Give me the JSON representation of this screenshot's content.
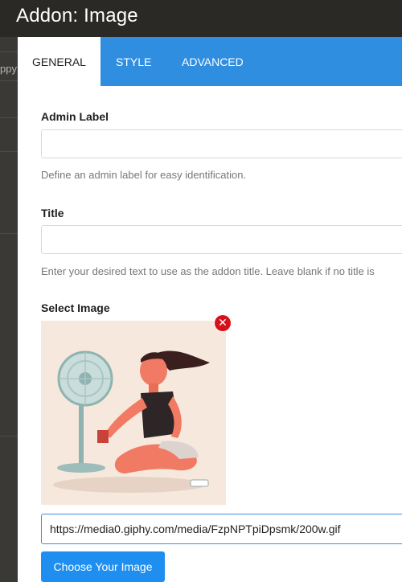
{
  "app": {
    "title": "Addon: Image"
  },
  "backdrop": {
    "fragment": "ppy"
  },
  "tabs": [
    {
      "label": "GENERAL",
      "active": true
    },
    {
      "label": "STYLE",
      "active": false
    },
    {
      "label": "ADVANCED",
      "active": false
    }
  ],
  "fields": {
    "admin_label": {
      "label": "Admin Label",
      "value": "",
      "help": "Define an admin label for easy identification."
    },
    "title": {
      "label": "Title",
      "value": "",
      "help": "Enter your desired text to use as the addon title. Leave blank if no title is"
    },
    "image": {
      "label": "Select Image",
      "url": "https://media0.giphy.com/media/FzpNPTpiDpsmk/200w.gif",
      "choose_label": "Choose Your Image",
      "remove_icon": "close-circle-icon"
    }
  },
  "colors": {
    "accent": "#2f8ee0",
    "button": "#1e8ff0",
    "remove": "#d7101a",
    "topbar": "#2a2925"
  }
}
